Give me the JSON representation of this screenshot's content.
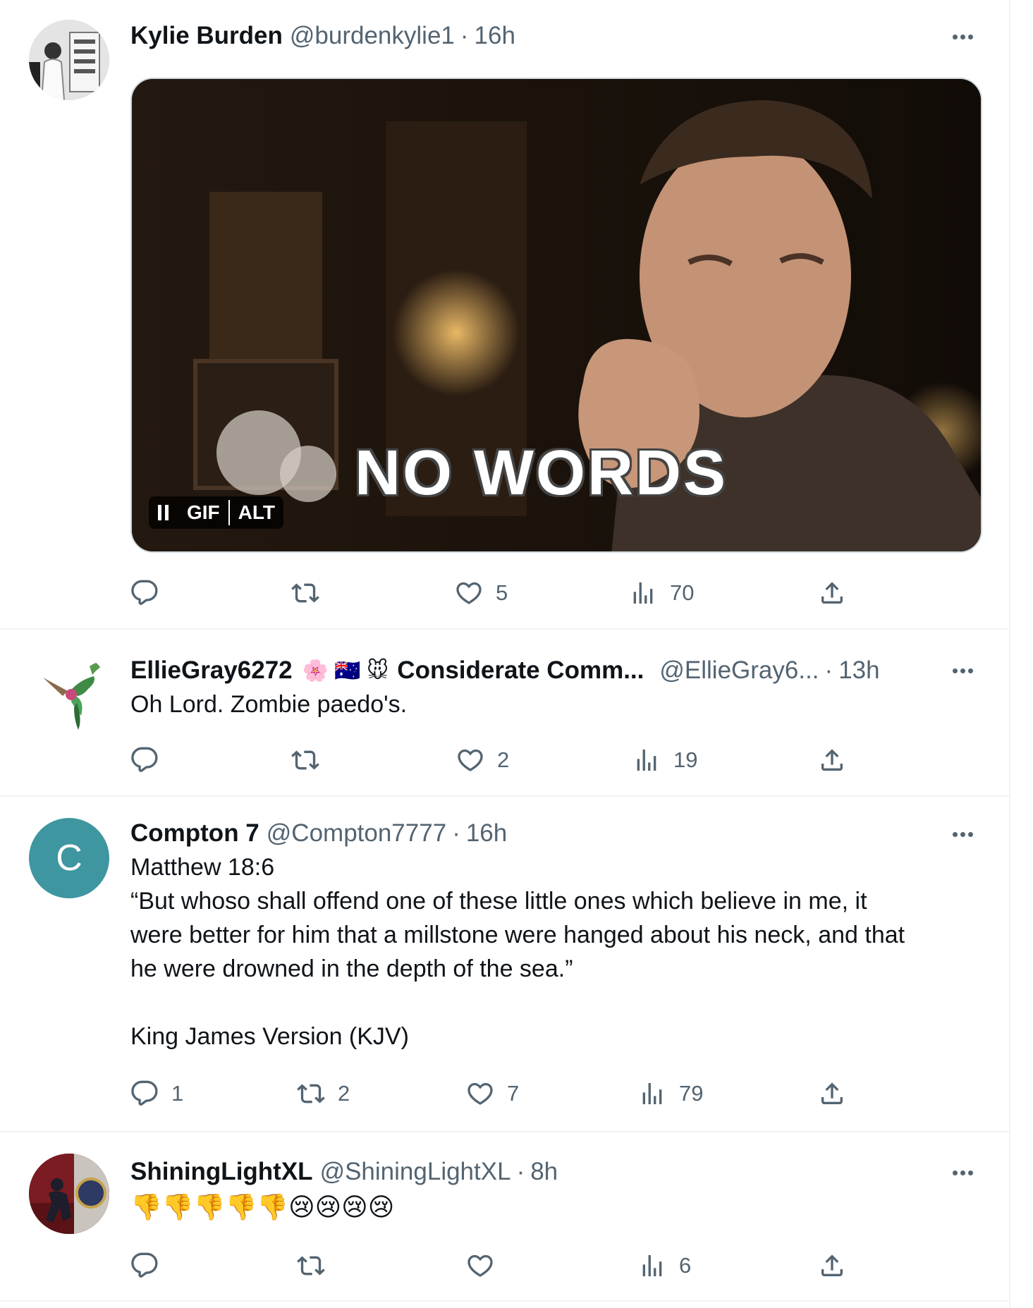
{
  "tweets": [
    {
      "name": "Kylie Burden",
      "handle": "@burdenkylie1",
      "dot": "·",
      "time": "16h",
      "media": {
        "caption": "NO WORDS",
        "gif_label": "GIF",
        "alt_label": "ALT"
      },
      "actions": {
        "replies": "",
        "retweets": "",
        "likes": "5",
        "views": "70"
      }
    },
    {
      "name": "EllieGray6272",
      "badges": "🌸 🇦🇺 🐭",
      "display_extra": "Considerate Comm...",
      "handle": "@EllieGray6...",
      "dot": "·",
      "time": "13h",
      "text": "Oh Lord. Zombie paedo's.",
      "actions": {
        "replies": "",
        "retweets": "",
        "likes": "2",
        "views": "19"
      }
    },
    {
      "name": "Compton 7",
      "avatar_letter": "C",
      "handle": "@Compton7777",
      "dot": "·",
      "time": "16h",
      "text_lines": [
        "Matthew 18:6",
        "“But whoso shall offend one of these little ones which believe in me, it",
        "were better for him that a millstone were hanged about his neck, and that",
        "he were drowned in the depth of the sea.”",
        "",
        "King James Version (KJV)"
      ],
      "actions": {
        "replies": "1",
        "retweets": "2",
        "likes": "7",
        "views": "79"
      }
    },
    {
      "name": "ShiningLightXL",
      "handle": "@ShiningLightXL",
      "dot": "·",
      "time": "8h",
      "text": "👎👎👎👎👎😢😢😢😢",
      "actions": {
        "replies": "",
        "retweets": "",
        "likes": "",
        "views": "6"
      }
    }
  ],
  "colors": {
    "muted": "#536471",
    "text": "#0f1419",
    "divider": "#eff3f4",
    "avatar_c": "#3e96a0"
  }
}
